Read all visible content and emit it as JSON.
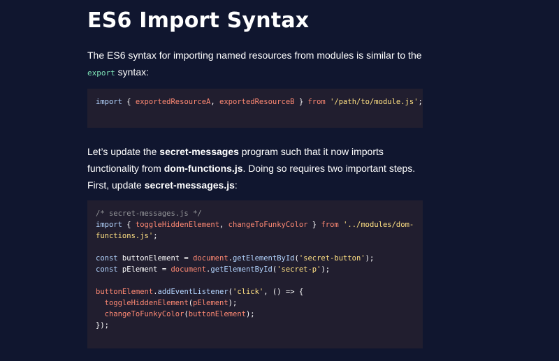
{
  "heading": "ES6 Import Syntax",
  "para1": {
    "text": "The ES6 syntax for importing named resources from modules is similar to the",
    "code": "export",
    "after": " syntax:"
  },
  "code1": {
    "import_kw": "import",
    "open": " { ",
    "name_a": "exportedResourceA",
    "comma": ", ",
    "name_b": "exportedResourceB",
    "close": " } ",
    "from_kw": "from",
    "space": " ",
    "path": "'/path/to/module.js'",
    "semi": ";"
  },
  "para2": {
    "t1": "Let’s update the ",
    "b1": "secret-messages",
    "t2": " program such that it now imports functionality from ",
    "b2": "dom-functions.js",
    "t3": ". Doing so requires two important steps. First, update ",
    "b3": "secret-messages.js",
    "t4": ":"
  },
  "code2": {
    "comment": "/* secret-messages.js */",
    "l2_import": "import",
    "l2_open": " { ",
    "l2_a": "toggleHiddenElement",
    "l2_comma": ", ",
    "l2_b": "changeToFunkyColor",
    "l2_close": " } ",
    "l2_from": "from",
    "l2_sp": " ",
    "l2_path1": "'../modules/dom-",
    "l3_path2": "functions.js'",
    "l3_semi": ";",
    "l5_const": "const",
    "l5_var": " buttonElement = ",
    "l5_doc": "document",
    "l5_dot": ".",
    "l5_method": "getElementById",
    "l5_open": "(",
    "l5_arg": "'secret-button'",
    "l5_close": ");",
    "l6_const": "const",
    "l6_var": " pElement = ",
    "l6_doc": "document",
    "l6_dot": ".",
    "l6_method": "getElementById",
    "l6_open": "(",
    "l6_arg": "'secret-p'",
    "l6_close": ");",
    "l8_obj": "buttonElement",
    "l8_dot": ".",
    "l8_method": "addEventListener",
    "l8_open": "(",
    "l8_arg": "'click'",
    "l8_rest": ", () => {",
    "l9_indent": "  ",
    "l9_fn": "toggleHiddenElement",
    "l9_open": "(",
    "l9_arg": "pElement",
    "l9_close": ");",
    "l10_indent": "  ",
    "l10_fn": "changeToFunkyColor",
    "l10_open": "(",
    "l10_arg": "buttonElement",
    "l10_close": ");",
    "l11": "});"
  },
  "colors": {
    "background": "#10162f",
    "code_background": "#211e2f",
    "keyword": "#b4d5ff",
    "identifier": "#ff8973",
    "string": "#ffe083",
    "comment": "#939598",
    "inline_code": "#7ee5b8"
  }
}
